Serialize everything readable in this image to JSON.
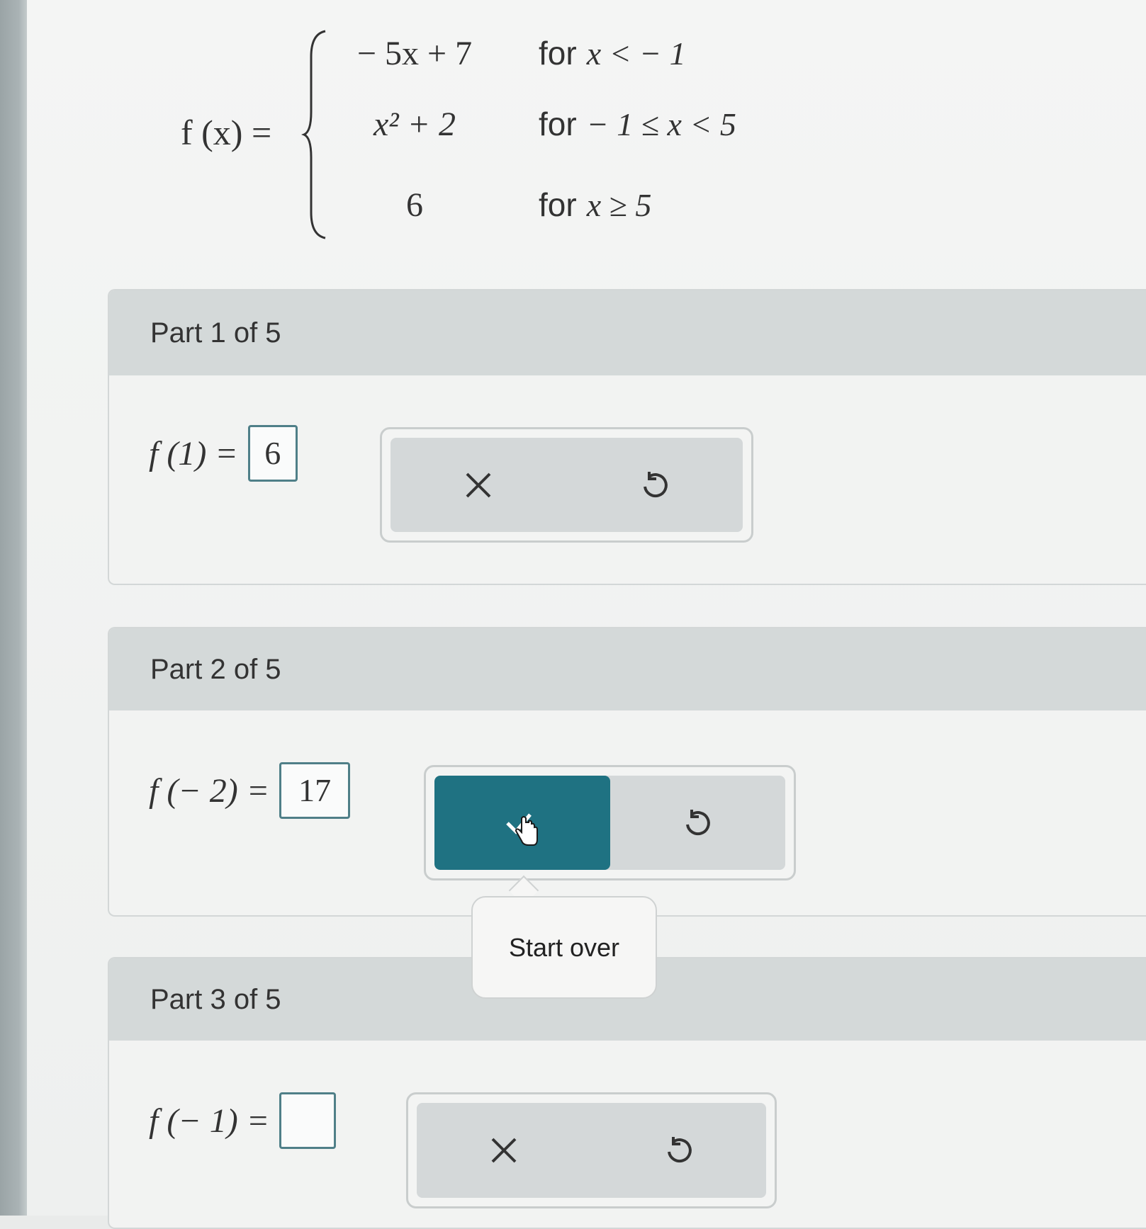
{
  "function_def": {
    "label": "f (x) =",
    "cases": [
      {
        "expr": "− 5x + 7",
        "cond_for": "for",
        "cond": "x < − 1"
      },
      {
        "expr": "x² + 2",
        "cond_for": "for",
        "cond": "− 1 ≤ x < 5"
      },
      {
        "expr": "6",
        "cond_for": "for",
        "cond": "x ≥ 5"
      }
    ]
  },
  "parts": [
    {
      "title": "Part 1 of 5",
      "lhs": "f (1) =",
      "answer": "6",
      "buttons": [
        "close-icon",
        "undo-icon"
      ]
    },
    {
      "title": "Part 2 of 5",
      "lhs": "f (− 2) =",
      "answer": "17",
      "buttons": [
        "check-icon",
        "undo-icon"
      ],
      "active_button": "check"
    },
    {
      "title": "Part 3 of 5",
      "lhs": "f (− 1) =",
      "answer": "",
      "buttons": [
        "close-icon",
        "undo-icon"
      ]
    }
  ],
  "tooltip": {
    "text": "Start over"
  },
  "colors": {
    "accent": "#1f7282",
    "input_border": "#4f7f88",
    "header_bg": "#d4d9d9"
  }
}
